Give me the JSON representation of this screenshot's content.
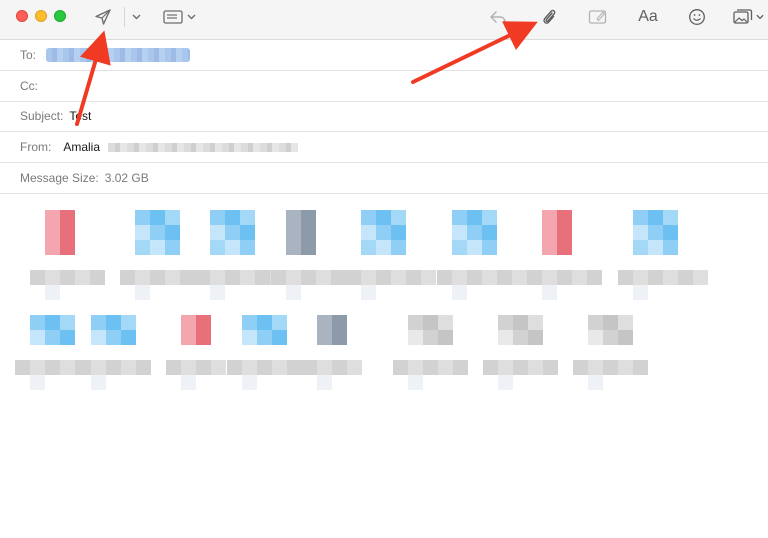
{
  "toolbar": {
    "icons": [
      "send-icon",
      "chevron-down-icon",
      "header-fields-icon",
      "chevron-down-icon",
      "reply-icon",
      "paperclip-icon",
      "markup-icon",
      "format-icon",
      "emoji-icon",
      "photo-browser-icon"
    ],
    "format_label": "Aa"
  },
  "headers": {
    "to_label": "To:",
    "cc_label": "Cc:",
    "subject_label": "Subject:",
    "subject_value": "Test",
    "from_label": "From:",
    "from_value": "Amalia",
    "size_label": "Message Size:",
    "size_value": "3.02 GB"
  },
  "colors": {
    "annotation_arrow": "#f03a24",
    "traffic_red": "#fe5f57",
    "traffic_yellow": "#febc2e",
    "traffic_green": "#28c840"
  }
}
